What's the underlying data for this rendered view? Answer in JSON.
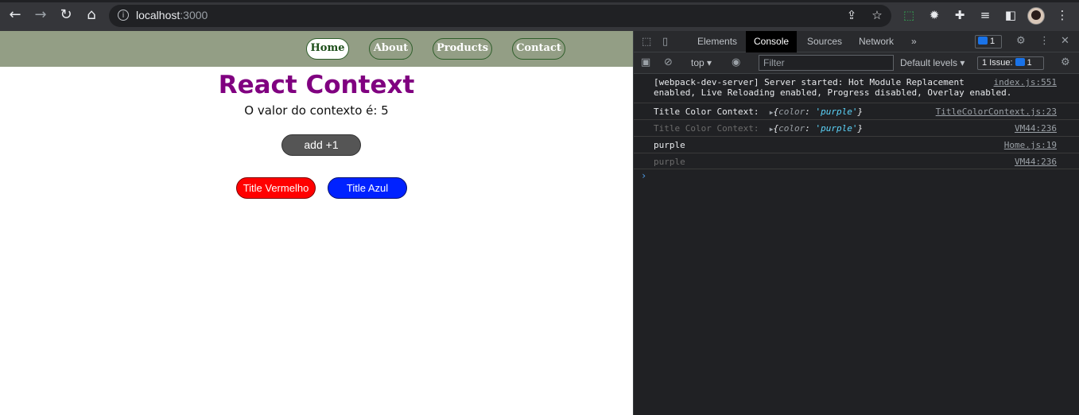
{
  "browser": {
    "url_host": "localhost",
    "url_port": ":3000",
    "icons": {
      "back": "arrow-left-icon",
      "forward": "arrow-right-icon",
      "reload": "reload-icon",
      "home": "home-icon",
      "info": "info-icon",
      "share": "share-icon",
      "bookmark": "star-icon",
      "extensions": "puzzle-icon",
      "menu": "kebab-menu-icon"
    }
  },
  "app": {
    "nav": [
      {
        "label": "Home",
        "active": true
      },
      {
        "label": "About",
        "active": false
      },
      {
        "label": "Products",
        "active": false
      },
      {
        "label": "Contact",
        "active": false
      }
    ],
    "title": "React Context",
    "context_text": "O valor do contexto é: 5",
    "add_button": "add +1",
    "red_button": "Title Vermelho",
    "blue_button": "Title Azul",
    "colors": {
      "navbar": "#939e85",
      "title": "#800080",
      "red": "#ff0000",
      "blue": "#0022ff"
    }
  },
  "devtools": {
    "tabs": [
      "Elements",
      "Console",
      "Sources",
      "Network"
    ],
    "active_tab": "Console",
    "more_tabs": "»",
    "messages_badge": "1",
    "toolbar": {
      "context": "top",
      "filter_placeholder": "Filter",
      "levels": "Default levels",
      "issues_label": "1 Issue:",
      "issues_count": "1"
    },
    "console_rows": [
      {
        "message": "[webpack-dev-server] Server started: Hot Module Replacement\nenabled, Live Reloading enabled, Progress disabled, Overlay enabled.",
        "source": "index.js:551"
      },
      {
        "message": "Title Color Context:",
        "object_key": "color",
        "object_value": "'purple'",
        "source": "TitleColorContext.js:23"
      },
      {
        "message": "Title Color Context:",
        "object_key": "color",
        "object_value": "'purple'",
        "source": "VM44:236"
      },
      {
        "message": "purple",
        "source": "Home.js:19"
      },
      {
        "message": "purple",
        "source": "VM44:236"
      }
    ],
    "prompt": "›"
  }
}
